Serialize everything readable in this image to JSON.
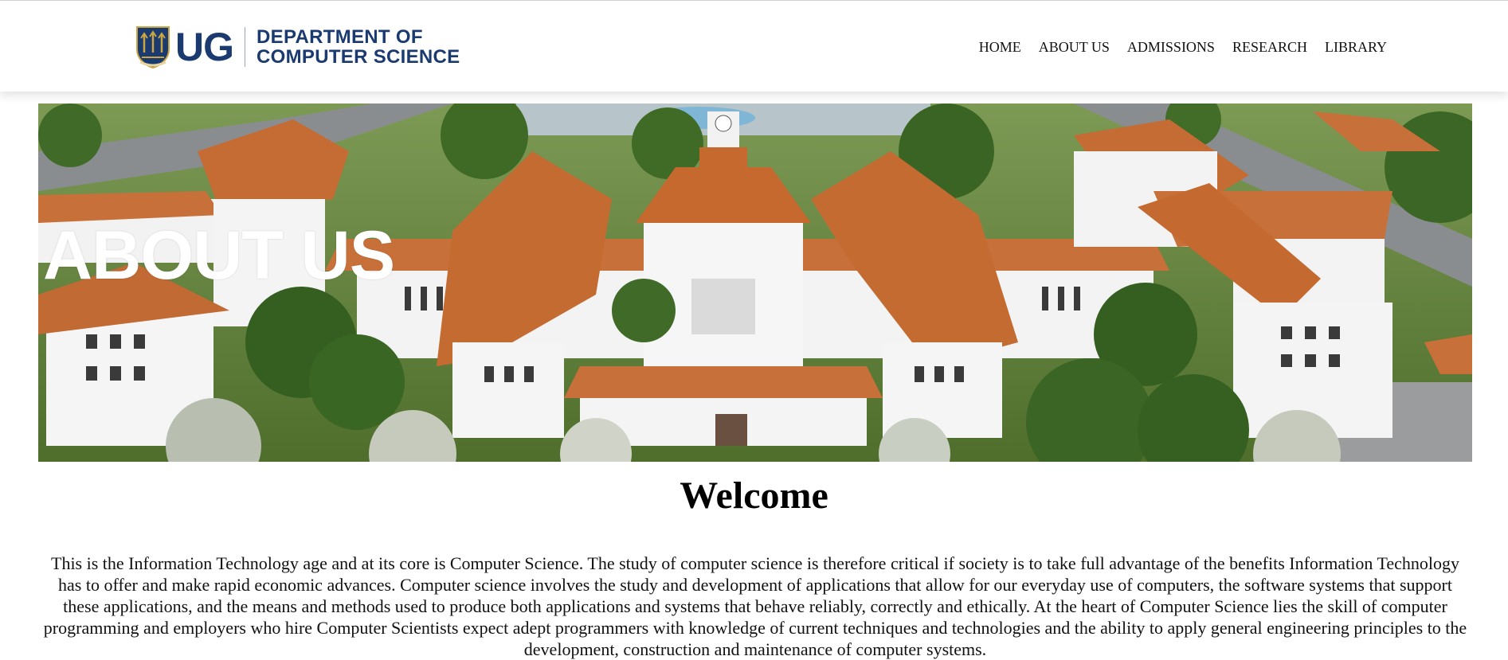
{
  "header": {
    "logo_text": "UG",
    "dept_line1": "DEPARTMENT OF",
    "dept_line2": "COMPUTER SCIENCE"
  },
  "nav": {
    "items": [
      {
        "label": "HOME"
      },
      {
        "label": "ABOUT US"
      },
      {
        "label": "ADMISSIONS"
      },
      {
        "label": "RESEARCH"
      },
      {
        "label": "LIBRARY"
      }
    ]
  },
  "hero": {
    "title": "ABOUT US",
    "image": "aerial-campus-photo"
  },
  "main": {
    "heading": "Welcome",
    "intro": "This is the Information Technology age and at its core is Computer Science. The study of computer science is therefore critical if society is to take full advantage of the benefits Information Technology has to offer and make rapid economic advances. Computer science involves the study and development of applications that allow for our everyday use of computers, the software systems that support these applications, and the means and methods used to produce both applications and systems that behave reliably, correctly and ethically. At the heart of Computer Science lies the skill of computer programming and employers who hire Computer Scientists expect adept programmers with knowledge of current techniques and technologies and the ability to apply general engineering principles to the development, construction and maintenance of computer systems."
  },
  "colors": {
    "brand": "#1a3a70",
    "roof": "#c8703a",
    "text": "#111111"
  }
}
